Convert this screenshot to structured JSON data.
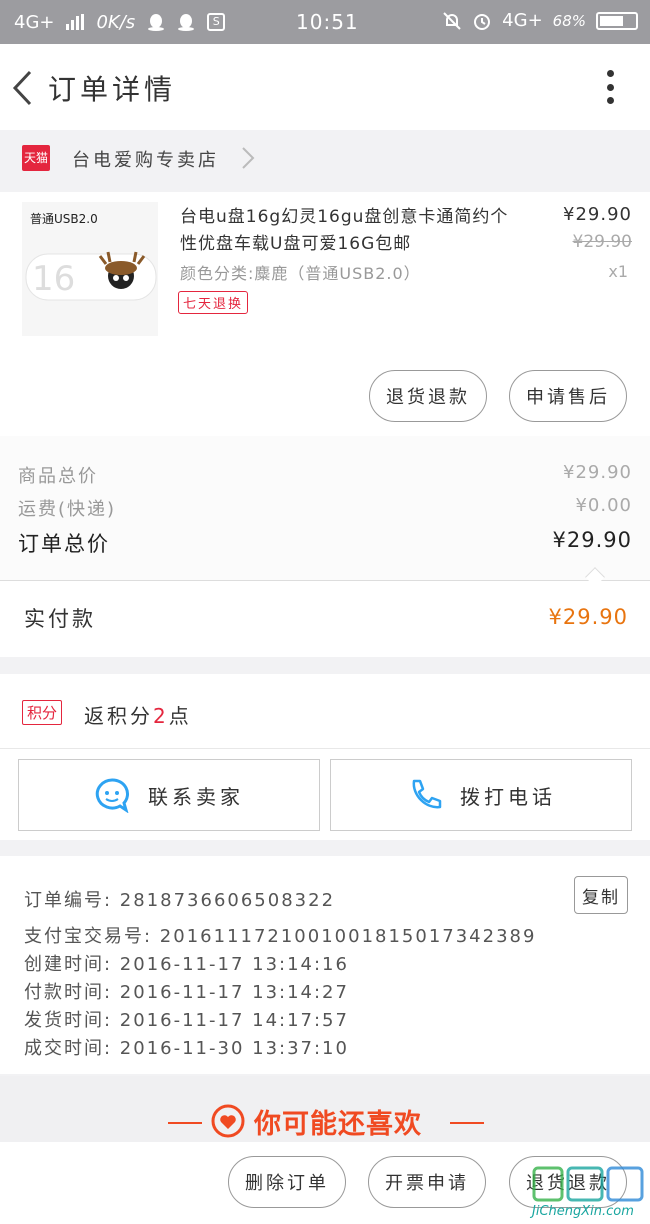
{
  "status_bar": {
    "network_left": "4G+",
    "speed": "0K/s",
    "time": "10:51",
    "network_right": "4G+",
    "battery": "68%"
  },
  "header": {
    "title": "订单详情"
  },
  "shop": {
    "badge": "天猫",
    "name": "台电爱购专卖店"
  },
  "product": {
    "image_label": "普通USB2.0",
    "title": "台电u盘16g幻灵16gu盘创意卡通简约个性优盘车载U盘可爱16G包邮",
    "sku": "颜色分类:麋鹿（普通USB2.0）",
    "tag": "七天退换",
    "price": "¥29.90",
    "original_price": "¥29.90",
    "quantity": "x1",
    "actions": [
      "退货退款",
      "申请售后"
    ]
  },
  "summary": {
    "rows": [
      {
        "label": "商品总价",
        "value": "¥29.90"
      },
      {
        "label": "运费(快递)",
        "value": "¥0.00"
      },
      {
        "label": "订单总价",
        "value": "¥29.90"
      }
    ],
    "paid_label": "实付款",
    "paid_value": "¥29.90"
  },
  "points": {
    "badge": "积分",
    "text_prefix": "返积分",
    "count": "2",
    "text_suffix": "点"
  },
  "contact": {
    "seller_label": "联系卖家",
    "phone_label": "拨打电话"
  },
  "order_info": {
    "rows": [
      "订单编号: 2818736606508322",
      "支付宝交易号: 2016111721001001815017342389",
      "创建时间: 2016-11-17  13:14:16",
      "付款时间: 2016-11-17  13:14:27",
      "发货时间: 2016-11-17  14:17:57",
      "成交时间: 2016-11-30  13:37:10"
    ],
    "copy_label": "复制"
  },
  "recommend": {
    "title": "你可能还喜欢"
  },
  "bottom_bar": {
    "buttons": [
      "删除订单",
      "开票申请",
      "退货退款"
    ]
  },
  "watermark": {
    "url": "JiChengXin.com"
  },
  "colors": {
    "accent_red": "#e4263e",
    "price_orange": "#e8740f",
    "recommend_orange": "#f04a22",
    "status_bar": "#9c9ca0"
  }
}
